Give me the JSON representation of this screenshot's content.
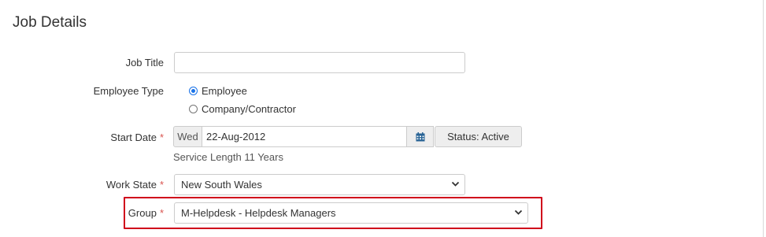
{
  "section": {
    "title": "Job Details"
  },
  "job_title": {
    "label": "Job Title",
    "value": ""
  },
  "employee_type": {
    "label": "Employee Type",
    "options": [
      {
        "label": "Employee",
        "selected": true
      },
      {
        "label": "Company/Contractor",
        "selected": false
      }
    ]
  },
  "start_date": {
    "label": "Start Date",
    "required_mark": "*",
    "day": "Wed",
    "value": "22-Aug-2012",
    "calendar_icon": "calendar-icon",
    "status_label": "Status: Active",
    "service_length": "Service Length 11 Years"
  },
  "work_state": {
    "label": "Work State",
    "required_mark": "*",
    "value": "New South Wales"
  },
  "group": {
    "label": "Group",
    "required_mark": "*",
    "value": "M-Helpdesk - Helpdesk Managers"
  },
  "colors": {
    "required": "#d9534f",
    "highlight": "#d0021b",
    "radio_checked": "#1a73e8",
    "calendar_icon": "#2a6496"
  }
}
